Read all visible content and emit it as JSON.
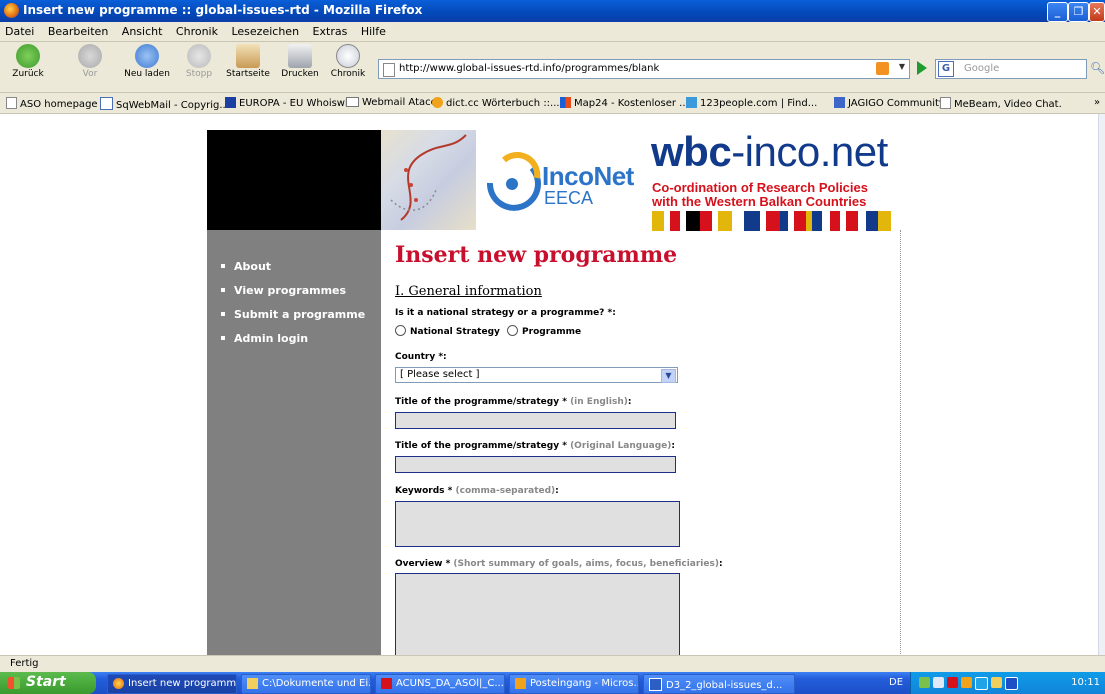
{
  "window": {
    "title": "Insert new programme :: global-issues-rtd - Mozilla Firefox"
  },
  "menu": [
    "Datei",
    "Bearbeiten",
    "Ansicht",
    "Chronik",
    "Lesezeichen",
    "Extras",
    "Hilfe"
  ],
  "toolbar": {
    "back": "Zurück",
    "forward": "Vor",
    "reload": "Neu laden",
    "stop": "Stopp",
    "home": "Startseite",
    "print": "Drucken",
    "history": "Chronik",
    "url": "http://www.global-issues-rtd.info/programmes/blank",
    "search_placeholder": "Google"
  },
  "bookmarks": [
    "ASO homepage",
    "SqWebMail - Copyrig...",
    "EUROPA - EU Whoiswho",
    "Webmail Ataco",
    "dict.cc Wörterbuch ::...",
    "Map24 - Kostenloser ...",
    "123people.com | Find...",
    "JAGIGO Community",
    "MeBeam, Video Chat."
  ],
  "site": {
    "inco_name": "IncoNet",
    "inco_sub": "EECA",
    "wbc_bold": "wbc",
    "wbc_rest": "-inco.net",
    "wbc_sub1": "Co-ordination of Research Policies",
    "wbc_sub2": "with the Western Balkan Countries",
    "nav": [
      "About",
      "View programmes",
      "Submit a programme",
      "Admin login"
    ]
  },
  "form": {
    "heading": "Insert new programme",
    "section": "I. General information",
    "q_type": "Is it a national strategy or a programme? *:",
    "opt_strategy": "National Strategy",
    "opt_programme": "Programme",
    "country_label": "Country *:",
    "country_value": "[ Please select ]",
    "title_en_label": "Title of the programme/strategy *",
    "title_en_hint": "(in English)",
    "title_orig_label": "Title of the programme/strategy *",
    "title_orig_hint": "(Original Language)",
    "keywords_label": "Keywords *",
    "keywords_hint": "(comma-separated)",
    "overview_label": "Overview *",
    "overview_hint": "(Short summary of goals, aims, focus, beneficiaries)",
    "colon": ":"
  },
  "status": "Fertig",
  "taskbar": {
    "start": "Start",
    "tasks": [
      "Insert new programm...",
      "C:\\Dokumente und Ei...",
      "ACUNS_DA_ASOl|_C...",
      "Posteingang - Micros...",
      "D3_2_global-issues_d..."
    ],
    "lang": "DE",
    "clock": "10:11"
  },
  "colors": {
    "heading_red": "#c8102e",
    "nav_grey": "#808080",
    "wbc_blue": "#123a8a",
    "wbc_red": "#d6111b",
    "inco_blue": "#2b74c8"
  }
}
